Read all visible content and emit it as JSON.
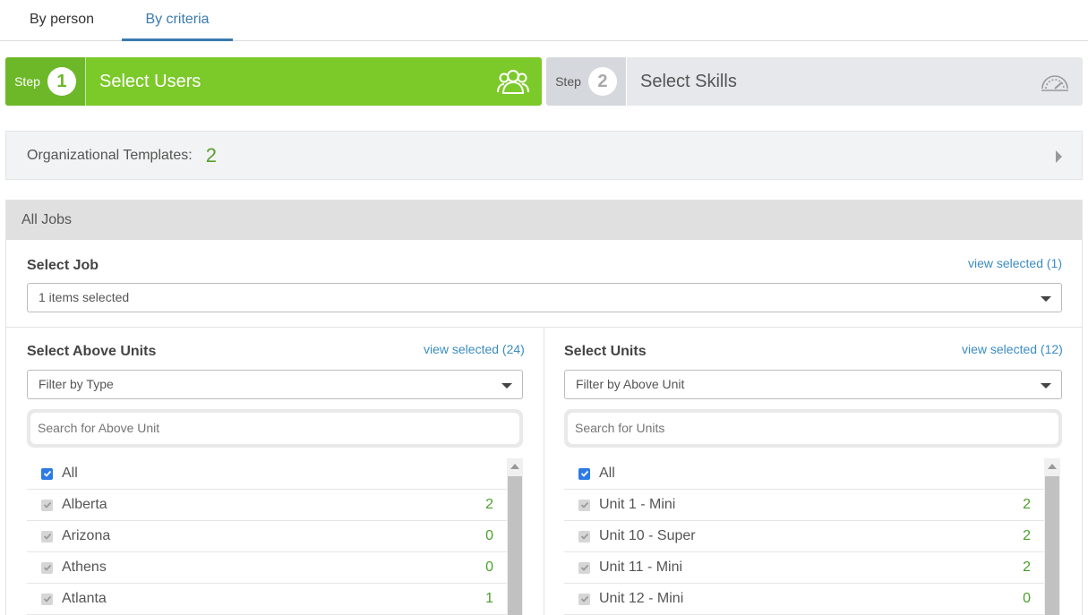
{
  "tabs": [
    {
      "label": "By person"
    },
    {
      "label": "By criteria"
    }
  ],
  "steps": [
    {
      "word": "Step",
      "number": "1",
      "title": "Select Users",
      "icon": "users-icon"
    },
    {
      "word": "Step",
      "number": "2",
      "title": "Select Skills",
      "icon": "gauge-icon"
    }
  ],
  "org_templates": {
    "label": "Organizational Templates:",
    "count": "2"
  },
  "panel": {
    "title": "All Jobs"
  },
  "job": {
    "title": "Select Job",
    "view_selected": "view selected (1)",
    "dropdown_value": "1 items selected"
  },
  "above_units": {
    "title": "Select Above Units",
    "view_selected": "view selected (24)",
    "filter": "Filter by Type",
    "search_placeholder": "Search for Above Unit",
    "items": [
      {
        "label": "All",
        "count": "",
        "checked": "on"
      },
      {
        "label": "Alberta",
        "count": "2",
        "checked": "dis"
      },
      {
        "label": "Arizona",
        "count": "0",
        "checked": "dis"
      },
      {
        "label": "Athens",
        "count": "0",
        "checked": "dis"
      },
      {
        "label": "Atlanta",
        "count": "1",
        "checked": "dis"
      }
    ]
  },
  "units": {
    "title": "Select Units",
    "view_selected": "view selected (12)",
    "filter": "Filter by Above Unit",
    "search_placeholder": "Search for Units",
    "items": [
      {
        "label": "All",
        "count": "",
        "checked": "on"
      },
      {
        "label": "Unit 1 - Mini",
        "count": "2",
        "checked": "dis"
      },
      {
        "label": "Unit 10 - Super",
        "count": "2",
        "checked": "dis"
      },
      {
        "label": "Unit 11 - Mini",
        "count": "2",
        "checked": "dis"
      },
      {
        "label": "Unit 12 - Mini",
        "count": "0",
        "checked": "dis"
      }
    ]
  },
  "colors": {
    "accent_green": "#7cc92a",
    "link_blue": "#3a8cc4",
    "count_green": "#4aa02c"
  }
}
